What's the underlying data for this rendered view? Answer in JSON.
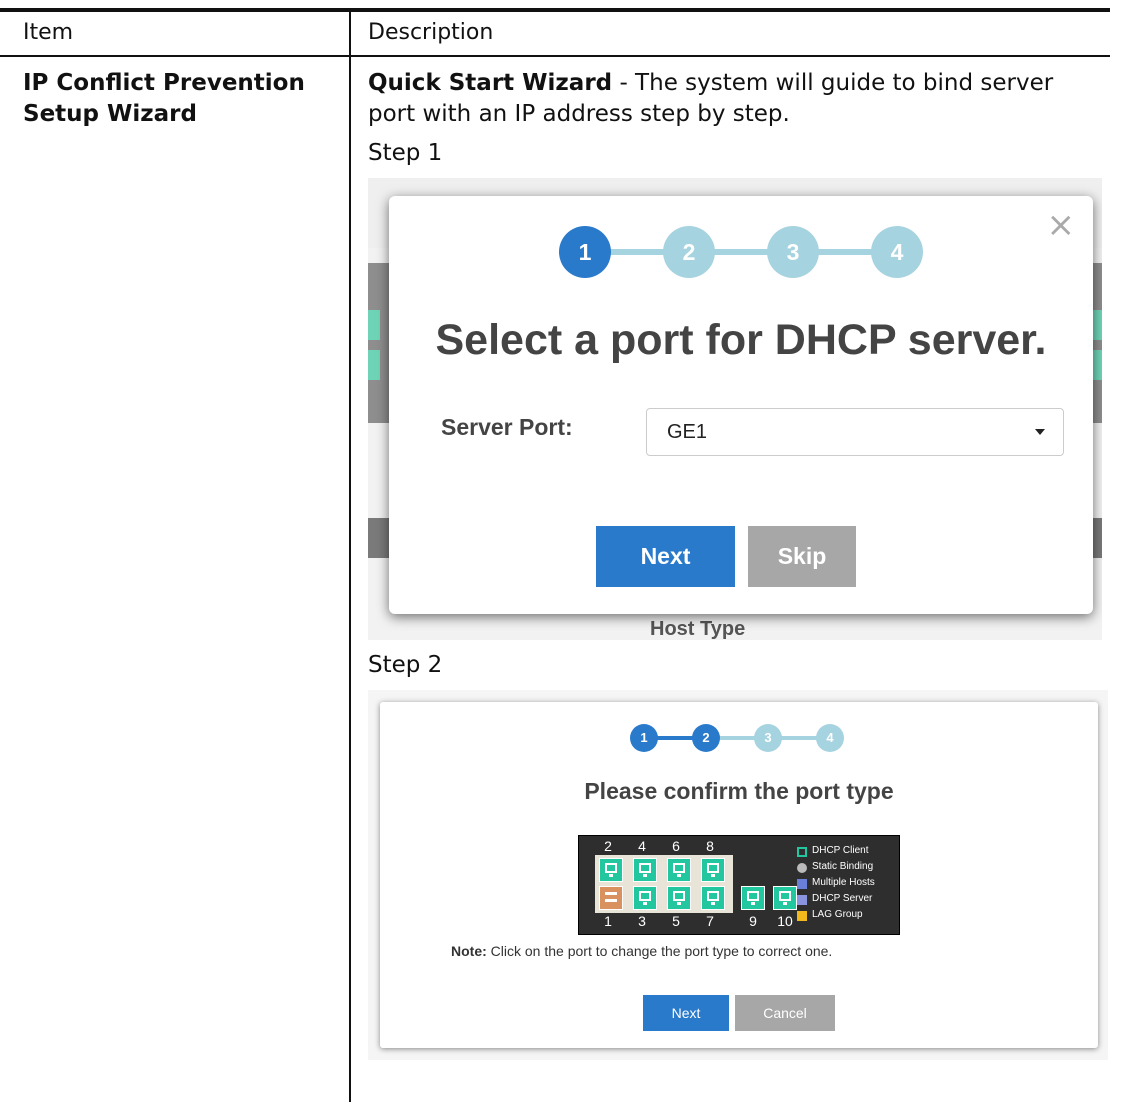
{
  "table": {
    "header_item": "Item",
    "header_description": "Description"
  },
  "row": {
    "item": "IP Conflict Prevention Setup Wizard",
    "desc_bold": "Quick Start Wizard",
    "desc_rest": " - The system will guide to bind server port with an IP address step by step.",
    "step1_label": "Step 1",
    "step2_label": "Step 2"
  },
  "step1": {
    "steps": [
      "1",
      "2",
      "3",
      "4"
    ],
    "active_step": 1,
    "title": "Select a port for DHCP server.",
    "server_port_label": "Server Port:",
    "server_port_value": "GE1",
    "next_button": "Next",
    "skip_button": "Skip",
    "close_glyph": "×",
    "background_text": "Host Type"
  },
  "step2": {
    "steps": [
      "1",
      "2",
      "3",
      "4"
    ],
    "active_step": 2,
    "title": "Please confirm the port type",
    "top_ports": [
      "2",
      "4",
      "6",
      "8"
    ],
    "bottom_ports": [
      "1",
      "3",
      "5",
      "7",
      "9",
      "10"
    ],
    "legend": [
      {
        "label": "DHCP Client",
        "color": "#22c7a0"
      },
      {
        "label": "Static Binding",
        "color": "#bbbbbb"
      },
      {
        "label": "Multiple Hosts",
        "color": "#6a7fd8"
      },
      {
        "label": "DHCP Server",
        "color": "#8a93e0"
      },
      {
        "label": "LAG Group",
        "color": "#f3b81b"
      }
    ],
    "note_bold": "Note:",
    "note_rest": " Click on the port to change the port type to correct one.",
    "next_button": "Next",
    "cancel_button": "Cancel"
  },
  "colors": {
    "primary": "#2a7acb",
    "step_inactive": "#a6d3e0",
    "secondary_button": "#a7a7a7",
    "port_client": "#22c7a0",
    "port_server": "#d9915f"
  }
}
